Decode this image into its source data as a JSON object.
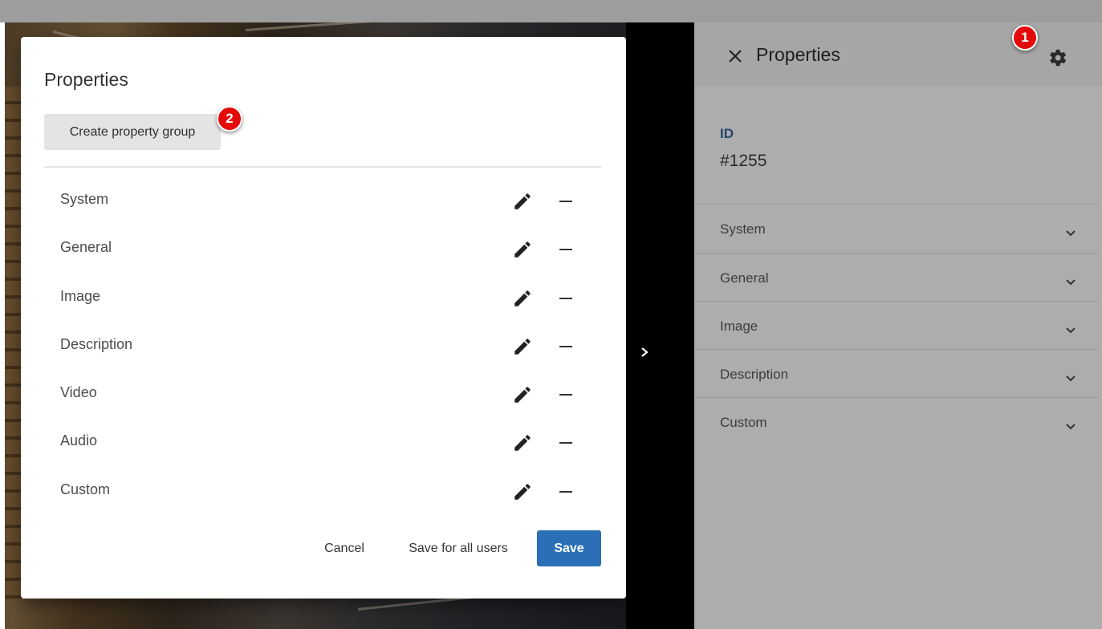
{
  "dialog": {
    "title": "Properties",
    "create_button": "Create property group",
    "groups": [
      {
        "label": "System"
      },
      {
        "label": "General"
      },
      {
        "label": "Image"
      },
      {
        "label": "Description"
      },
      {
        "label": "Video"
      },
      {
        "label": "Audio"
      },
      {
        "label": "Custom"
      }
    ],
    "cancel_label": "Cancel",
    "save_all_label": "Save for all users",
    "save_label": "Save"
  },
  "panel": {
    "title": "Properties",
    "id_label": "ID",
    "id_value": "#1255",
    "sections": [
      {
        "label": "System"
      },
      {
        "label": "General"
      },
      {
        "label": "Image"
      },
      {
        "label": "Description"
      },
      {
        "label": "Custom"
      }
    ]
  },
  "markers": {
    "first": "1",
    "second": "2"
  },
  "icons": {
    "panel_close": "close-icon",
    "panel_settings": "gear-icon",
    "section_expand": "chevron-down-icon",
    "group_edit": "pencil-icon",
    "group_remove": "minus-icon",
    "viewer_expand": "chevron-right-icon"
  },
  "colors": {
    "accent": "#2b6fb6",
    "marker": "#e50a0a",
    "id_label": "#23456e"
  }
}
